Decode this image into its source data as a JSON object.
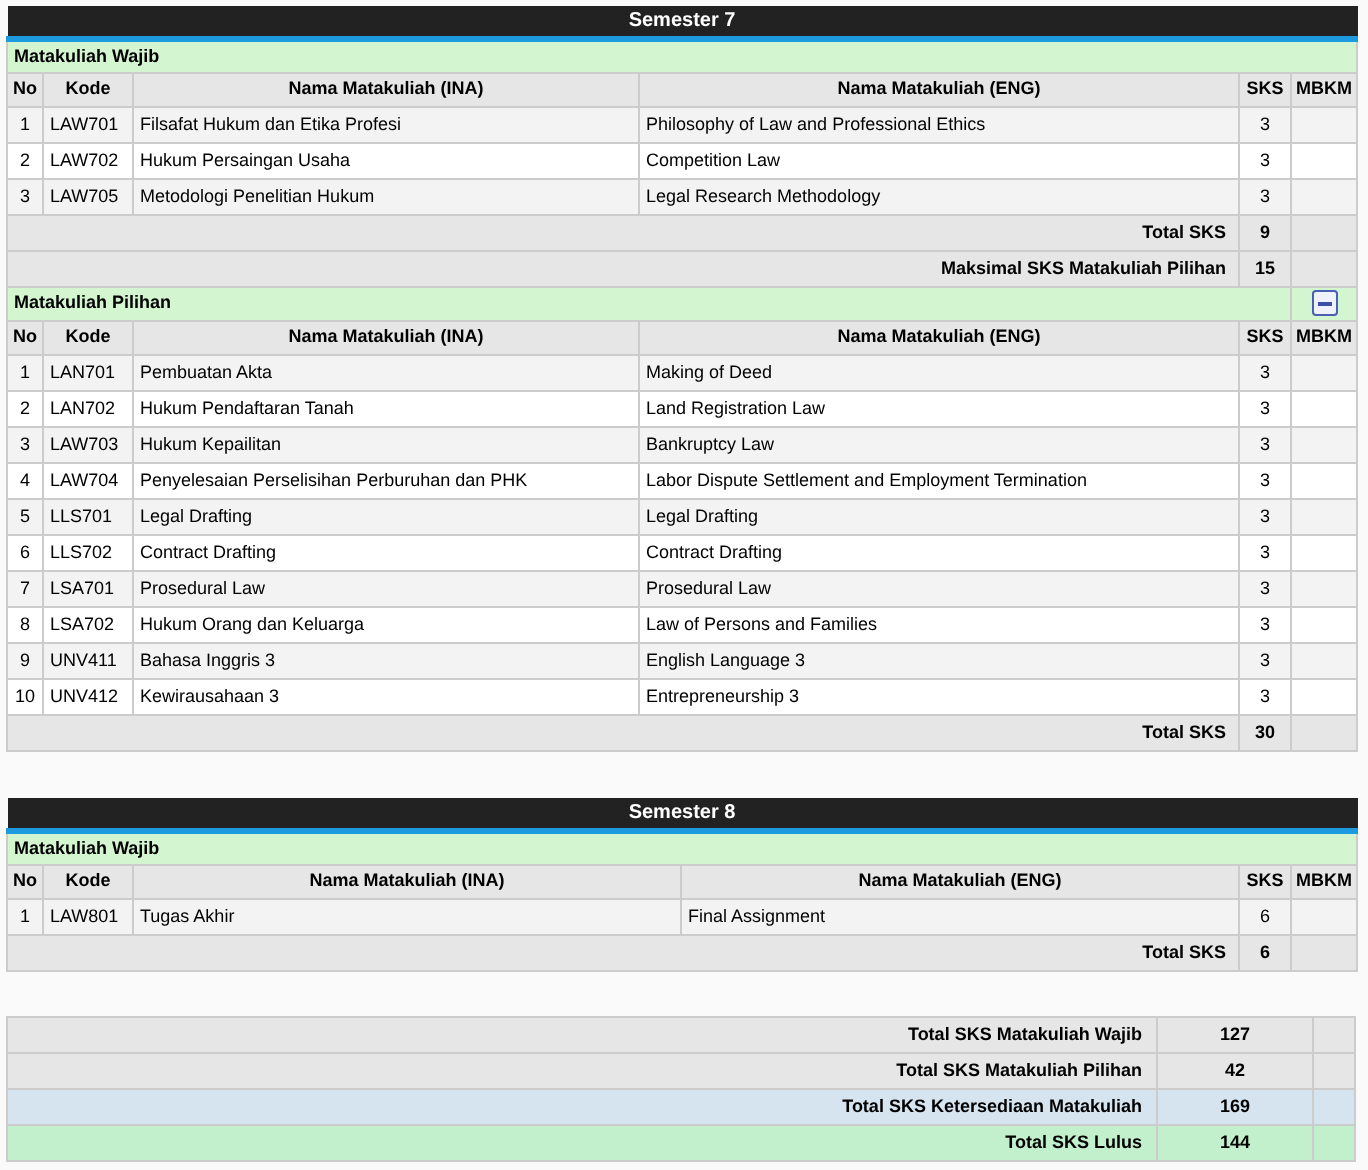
{
  "semesters": [
    {
      "title": "Semester 7",
      "sections": [
        {
          "title": "Matakuliah Wajib",
          "collapse_button": false,
          "columns": [
            "No",
            "Kode",
            "Nama Matakuliah (INA)",
            "Nama Matakuliah (ENG)",
            "SKS",
            "MBKM"
          ],
          "rows": [
            {
              "no": "1",
              "kode": "LAW701",
              "ina": "Filsafat Hukum dan Etika Profesi",
              "eng": "Philosophy of Law and Professional Ethics",
              "sks": "3"
            },
            {
              "no": "2",
              "kode": "LAW702",
              "ina": "Hukum Persaingan Usaha",
              "eng": "Competition Law",
              "sks": "3"
            },
            {
              "no": "3",
              "kode": "LAW705",
              "ina": "Metodologi Penelitian Hukum",
              "eng": "Legal Research Methodology",
              "sks": "3"
            }
          ],
          "totals": [
            {
              "label": "Total SKS",
              "value": "9"
            },
            {
              "label": "Maksimal SKS Matakuliah Pilihan",
              "value": "15"
            }
          ]
        },
        {
          "title": "Matakuliah Pilihan",
          "collapse_button": true,
          "columns": [
            "No",
            "Kode",
            "Nama Matakuliah (INA)",
            "Nama Matakuliah (ENG)",
            "SKS",
            "MBKM"
          ],
          "rows": [
            {
              "no": "1",
              "kode": "LAN701",
              "ina": "Pembuatan Akta",
              "eng": "Making of Deed",
              "sks": "3"
            },
            {
              "no": "2",
              "kode": "LAN702",
              "ina": "Hukum Pendaftaran Tanah",
              "eng": "Land Registration Law",
              "sks": "3"
            },
            {
              "no": "3",
              "kode": "LAW703",
              "ina": "Hukum Kepailitan",
              "eng": "Bankruptcy Law",
              "sks": "3"
            },
            {
              "no": "4",
              "kode": "LAW704",
              "ina": "Penyelesaian Perselisihan Perburuhan dan PHK",
              "eng": "Labor Dispute Settlement and Employment Termination",
              "sks": "3"
            },
            {
              "no": "5",
              "kode": "LLS701",
              "ina": "Legal Drafting",
              "eng": "Legal Drafting",
              "sks": "3"
            },
            {
              "no": "6",
              "kode": "LLS702",
              "ina": "Contract Drafting",
              "eng": "Contract Drafting",
              "sks": "3"
            },
            {
              "no": "7",
              "kode": "LSA701",
              "ina": "Prosedural Law",
              "eng": "Prosedural Law",
              "sks": "3"
            },
            {
              "no": "8",
              "kode": "LSA702",
              "ina": "Hukum Orang dan Keluarga",
              "eng": "Law of Persons and Families",
              "sks": "3"
            },
            {
              "no": "9",
              "kode": "UNV411",
              "ina": "Bahasa Inggris 3",
              "eng": "English Language 3",
              "sks": "3"
            },
            {
              "no": "10",
              "kode": "UNV412",
              "ina": "Kewirausahaan 3",
              "eng": "Entrepreneurship 3",
              "sks": "3"
            }
          ],
          "totals": [
            {
              "label": "Total SKS",
              "value": "30"
            }
          ]
        }
      ]
    },
    {
      "title": "Semester 8",
      "sections": [
        {
          "title": "Matakuliah Wajib",
          "collapse_button": false,
          "columns": [
            "No",
            "Kode",
            "Nama Matakuliah (INA)",
            "Nama Matakuliah (ENG)",
            "SKS",
            "MBKM"
          ],
          "rows": [
            {
              "no": "1",
              "kode": "LAW801",
              "ina": "Tugas Akhir",
              "eng": "Final Assignment",
              "sks": "6"
            }
          ],
          "totals": [
            {
              "label": "Total SKS",
              "value": "6"
            }
          ]
        }
      ]
    }
  ],
  "summary": [
    {
      "label": "Total SKS Matakuliah Wajib",
      "value": "127",
      "kind": "plain"
    },
    {
      "label": "Total SKS Matakuliah Pilihan",
      "value": "42",
      "kind": "plain"
    },
    {
      "label": "Total SKS Ketersediaan Matakuliah",
      "value": "169",
      "kind": "available"
    },
    {
      "label": "Total SKS Lulus",
      "value": "144",
      "kind": "passed"
    }
  ]
}
